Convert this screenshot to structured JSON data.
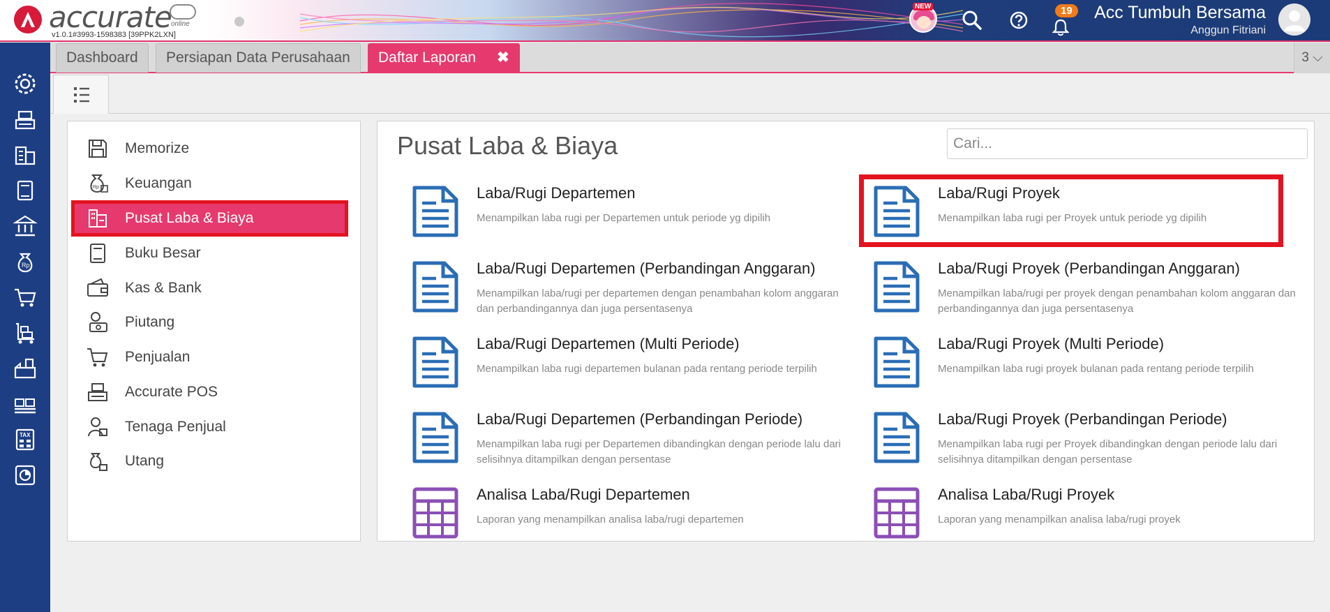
{
  "header": {
    "logo_text": "accurate",
    "logo_sub": "online",
    "version": "v1.0.1#3993-1598383 [39PPK2LXN]",
    "new_label": "NEW",
    "notification_count": "19",
    "company_name": "Acc Tumbuh Bersama",
    "user_name": "Anggun Fitriani",
    "icons": [
      "new-feature-avatar",
      "search-icon",
      "help-icon",
      "bell-icon",
      "user-avatar"
    ]
  },
  "sidebar": {
    "icons": [
      "settings-icon",
      "cashier-icon",
      "company-icon",
      "ledger-book-icon",
      "bank-icon",
      "money-bag-icon",
      "cart-icon",
      "inventory-trolley-icon",
      "factory-icon",
      "pallet-icon",
      "tax-icon",
      "report-chart-icon"
    ]
  },
  "tabs": [
    {
      "label": "Dashboard"
    },
    {
      "label": "Persiapan Data Perusahaan"
    },
    {
      "label": "Daftar Laporan",
      "close": "✖"
    }
  ],
  "tab_count": "3 ⌵",
  "categories": [
    {
      "label": "Memorize",
      "icon": "floppy-disk-icon"
    },
    {
      "label": "Keuangan",
      "icon": "money-bag-icon"
    },
    {
      "label": "Pusat Laba & Biaya",
      "icon": "building-chart-icon",
      "selected": true
    },
    {
      "label": "Buku Besar",
      "icon": "ledger-book-icon"
    },
    {
      "label": "Kas & Bank",
      "icon": "wallet-icon"
    },
    {
      "label": "Piutang",
      "icon": "receivable-person-icon"
    },
    {
      "label": "Penjualan",
      "icon": "cart-icon"
    },
    {
      "label": "Accurate POS",
      "icon": "cashier-icon"
    },
    {
      "label": "Tenaga Penjual",
      "icon": "salesperson-icon"
    },
    {
      "label": "Utang",
      "icon": "payable-icon"
    }
  ],
  "main": {
    "title": "Pusat Laba & Biaya",
    "search_placeholder": "Cari...",
    "reports": [
      {
        "title": "Laba/Rugi Departemen",
        "desc": "Menampilkan laba rugi per Departemen untuk periode yg dipilih",
        "icon": "document-icon"
      },
      {
        "title": "Laba/Rugi Proyek",
        "desc": "Menampilkan laba rugi per Proyek untuk periode yg dipilih",
        "icon": "document-icon"
      },
      {
        "title": "Laba/Rugi Departemen (Perbandingan Anggaran)",
        "desc": "Menampilkan laba/rugi per departemen dengan penambahan kolom anggaran dan perbandingannya dan juga persentasenya",
        "icon": "document-icon"
      },
      {
        "title": "Laba/Rugi Proyek (Perbandingan Anggaran)",
        "desc": "Menampilkan laba/rugi per proyek dengan penambahan kolom anggaran dan perbandingannya dan juga persentasenya",
        "icon": "document-icon"
      },
      {
        "title": "Laba/Rugi Departemen (Multi Periode)",
        "desc": "Menampilkan laba rugi departemen bulanan pada rentang periode terpilih",
        "icon": "document-icon"
      },
      {
        "title": "Laba/Rugi Proyek (Multi Periode)",
        "desc": "Menampilkan laba rugi proyek bulanan pada rentang periode terpilih",
        "icon": "document-icon"
      },
      {
        "title": "Laba/Rugi Departemen (Perbandingan Periode)",
        "desc": "Menampilkan laba rugi per Departemen dibandingkan dengan periode lalu dari selisihnya ditampilkan dengan persentase",
        "icon": "document-icon"
      },
      {
        "title": "Laba/Rugi Proyek (Perbandingan Periode)",
        "desc": "Menampilkan laba rugi per Proyek dibandingkan dengan periode lalu dari selisihnya ditampilkan dengan persentase",
        "icon": "document-icon"
      },
      {
        "title": "Analisa Laba/Rugi Departemen",
        "desc": "Laporan yang menampilkan analisa laba/rugi departemen",
        "icon": "grid-table-icon"
      },
      {
        "title": "Analisa Laba/Rugi Proyek",
        "desc": "Laporan yang menampilkan analisa laba/rugi proyek",
        "icon": "grid-table-icon"
      }
    ]
  },
  "colors": {
    "accent": "#e63a6e",
    "highlight_border": "#e3131f",
    "sidebar": "#1d3e82",
    "doc_icon": "#2a6db5",
    "grid_icon": "#8b4fb5"
  }
}
